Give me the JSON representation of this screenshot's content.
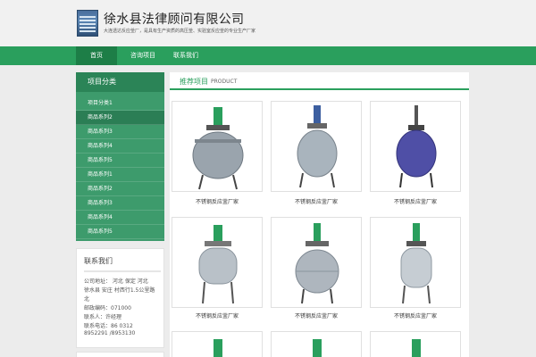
{
  "header": {
    "company_name": "徐水县法律顾问有限公司",
    "tagline": "大连透达反应釜厂，是具有生产资质的高压釜、实验室反应釜的专业生产厂家"
  },
  "nav": {
    "items": [
      {
        "label": "首页",
        "active": true
      },
      {
        "label": "咨询项目",
        "active": false
      },
      {
        "label": "联系我们",
        "active": false
      }
    ]
  },
  "sidebar": {
    "category_title": "项目分类",
    "items": [
      {
        "label": "项目分类1",
        "active": false
      },
      {
        "label": "商品系列2",
        "active": true
      },
      {
        "label": "商品系列3",
        "active": false
      },
      {
        "label": "商品系列4",
        "active": false
      },
      {
        "label": "商品系列5",
        "active": false
      },
      {
        "label": "商品系列1",
        "active": false
      },
      {
        "label": "商品系列2",
        "active": false
      },
      {
        "label": "商品系列3",
        "active": false
      },
      {
        "label": "商品系列4",
        "active": false
      },
      {
        "label": "商品系列5",
        "active": false
      }
    ]
  },
  "contact": {
    "title": "联系我们",
    "lines": [
      "公司地址：  河北 保定 河北",
      "徐水县 安庄 村西行1.5公里路",
      "北",
      "邮政编码：071000",
      "联系人：许经理",
      "联系电话：86 0312",
      "8952291 /8953130"
    ]
  },
  "main": {
    "title_cn": "推荐项目",
    "title_en": "PRODUCT",
    "products": [
      {
        "caption": "不锈钢反应釜厂家",
        "icon": "reactor-icon",
        "color": "#9aa4ad"
      },
      {
        "caption": "不锈钢反应釜厂家",
        "icon": "reactor-icon",
        "color": "#a9b4bd"
      },
      {
        "caption": "不锈钢反应釜厂家",
        "icon": "reactor-icon",
        "color": "#4f4fa6"
      },
      {
        "caption": "不锈钢反应釜厂家",
        "icon": "reactor-icon",
        "color": "#b9c1c8"
      },
      {
        "caption": "不锈钢反应釜厂家",
        "icon": "reactor-icon",
        "color": "#aeb6be"
      },
      {
        "caption": "不锈钢反应釜厂家",
        "icon": "reactor-icon",
        "color": "#c6cdd3"
      }
    ]
  },
  "colors": {
    "brand_green": "#2a9f5d",
    "sidebar_green": "#3d9b6c"
  }
}
